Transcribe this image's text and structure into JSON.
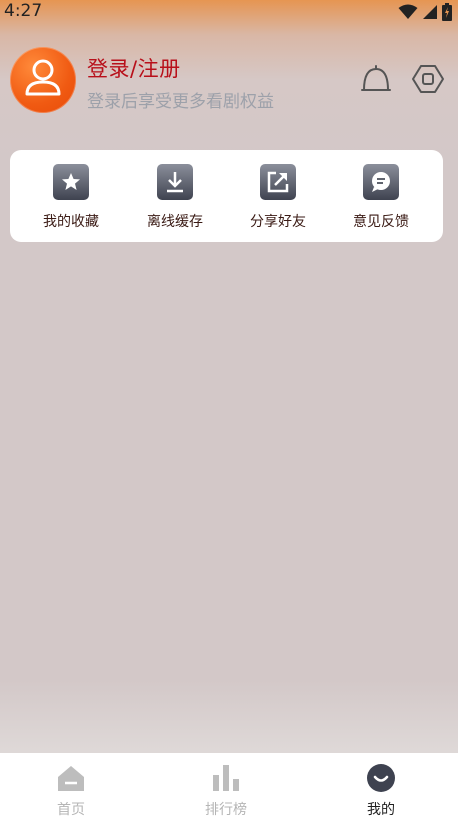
{
  "status_bar": {
    "time": "4:27"
  },
  "header": {
    "login_title": "登录/注册",
    "login_subtitle": "登录后享受更多看剧权益"
  },
  "quick_actions": [
    {
      "label": "我的收藏",
      "icon": "star-icon"
    },
    {
      "label": "离线缓存",
      "icon": "download-icon"
    },
    {
      "label": "分享好友",
      "icon": "share-icon"
    },
    {
      "label": "意见反馈",
      "icon": "feedback-icon"
    }
  ],
  "tabbar": {
    "tabs": [
      {
        "label": "首页",
        "icon": "home-icon",
        "active": false
      },
      {
        "label": "排行榜",
        "icon": "ranking-icon",
        "active": false
      },
      {
        "label": "我的",
        "icon": "mine-icon",
        "active": true
      }
    ]
  },
  "colors": {
    "accent": "#b8101a",
    "avatar": "#f05a12",
    "header_gradient_top": "#e69552",
    "background": "#d3c8c8"
  }
}
